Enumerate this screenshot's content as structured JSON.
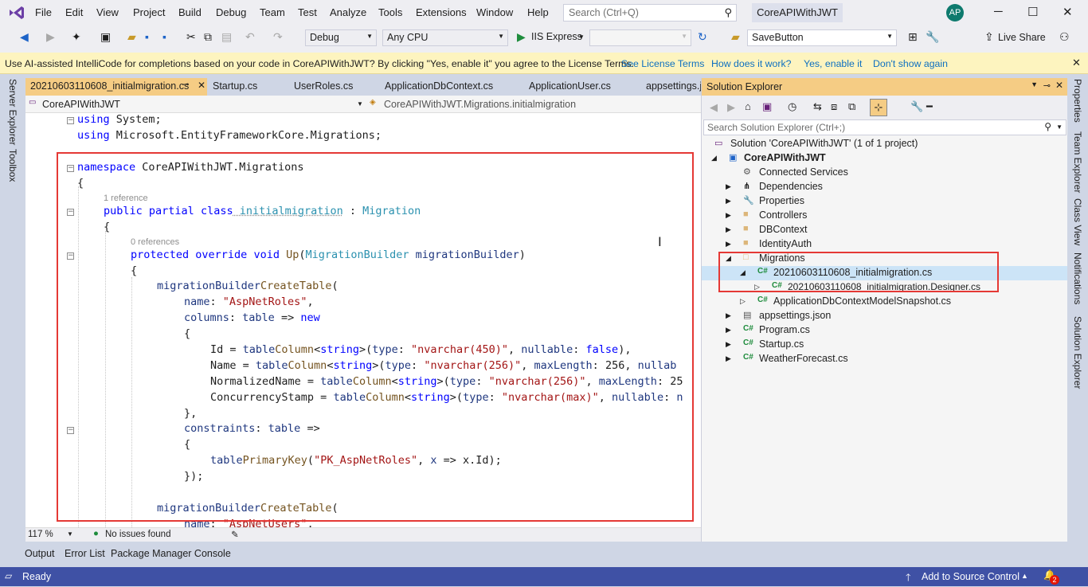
{
  "menubar": {
    "items": [
      "File",
      "Edit",
      "View",
      "Project",
      "Build",
      "Debug",
      "Team",
      "Test",
      "Analyze",
      "Tools",
      "Extensions",
      "Window",
      "Help"
    ],
    "search_placeholder": "Search (Ctrl+Q)",
    "solution_name": "CoreAPIWithJWT",
    "avatar": "AP"
  },
  "toolbar": {
    "config": "Debug",
    "platform": "Any CPU",
    "run_target": "IIS Express",
    "find_combo": "SaveButton",
    "live_share": "Live Share"
  },
  "infobar": {
    "message": "Use AI-assisted IntelliCode for completions based on your code in CoreAPIWithJWT?  By clicking \"Yes, enable it\" you agree to the License Terms.",
    "links": [
      "See License Terms",
      "How does it work?",
      "Yes, enable it",
      "Don't show again"
    ]
  },
  "left_strip": [
    "Server Explorer",
    "Toolbox"
  ],
  "right_strip": [
    "Properties",
    "Team Explorer",
    "Class View",
    "Notifications",
    "Solution Explorer"
  ],
  "tabs": [
    "20210603110608_initialmigration.cs",
    "Startup.cs",
    "UserRoles.cs",
    "ApplicationDbContext.cs",
    "ApplicationUser.cs",
    "appsettings.j"
  ],
  "navbar": {
    "project": "CoreAPIWithJWT",
    "type": "CoreAPIWithJWT.Migrations.initialmigration"
  },
  "code": {
    "l1a": "using",
    "l1b": " System;",
    "l2a": "using",
    "l2b": " Microsoft.EntityFrameworkCore.Migrations;",
    "l3a": "namespace",
    "l3b": " CoreAPIWithJWT.Migrations",
    "brace_open": "{",
    "brace_close": "}",
    "ref1": "1 reference",
    "l5a": "public",
    "l5b": " partial",
    "l5c": " class",
    "l5d": " initialmigration",
    "l5e": " : ",
    "l5f": "Migration",
    "ref0": "0 references",
    "l7a": "protected",
    "l7b": " override",
    "l7c": " void",
    "l7d": " Up",
    "l7e": "(",
    "l7f": "MigrationBuilder",
    "l7g": " migrationBuilder",
    ")": ")",
    "mb": "migrationBuilder",
    ".": ".",
    "ct": "CreateTable",
    "(": "(",
    "name": "name",
    "colon": ": ",
    "aspnetroles": "\"AspNetRoles\"",
    ",": ",",
    "columns": "columns",
    "table": "table",
    " => ": " => ",
    "new": "new",
    "id_lhs": "Id = ",
    "name_lhs": "Name = ",
    "norm_lhs": "NormalizedName = ",
    "cs_lhs": "ConcurrencyStamp = ",
    "column": "Column",
    "string": "string",
    "<": "<",
    ">": ">",
    "type": "type",
    "nv450": "\"nvarchar(450)\"",
    "nv256": "\"nvarchar(256)\"",
    "nvmax": "\"nvarchar(max)\"",
    "nullable": "nullable",
    "false": "false",
    "maxLength": "maxLength",
    "256": " 256",
    "nullab": " nullab",
    "25": " 25",
    "nul1": " n",
    "close_comma": "},",
    "constraints": "constraints",
    "pk": "PrimaryKey",
    "pk_name": "\"PK_AspNetRoles\"",
    "x": "x",
    "xid": " => x.Id);",
    "end_ct": "});",
    "aspnetusers": "\"AspNetUsers\""
  },
  "editor_status": {
    "zoom": "117 %",
    "issues": "No issues found"
  },
  "solution_explorer": {
    "title": "Solution Explorer",
    "search_placeholder": "Search Solution Explorer (Ctrl+;)",
    "items": [
      "Solution 'CoreAPIWithJWT' (1 of 1 project)",
      "CoreAPIWithJWT",
      "Connected Services",
      "Dependencies",
      "Properties",
      "Controllers",
      "DBContext",
      "IdentityAuth",
      "Migrations",
      "20210603110608_initialmigration.cs",
      "20210603110608_initialmigration.Designer.cs",
      "ApplicationDbContextModelSnapshot.cs",
      "appsettings.json",
      "Program.cs",
      "Startup.cs",
      "WeatherForecast.cs"
    ]
  },
  "bottom_tabs": [
    "Output",
    "Error List",
    "Package Manager Console"
  ],
  "statusbar": {
    "ready": "Ready",
    "source_control": "Add to Source Control",
    "notif_count": "2"
  },
  "colors": {
    "accent": "#3f51a5",
    "highlight_box": "#e53935",
    "active_tab": "#f5cc84"
  }
}
